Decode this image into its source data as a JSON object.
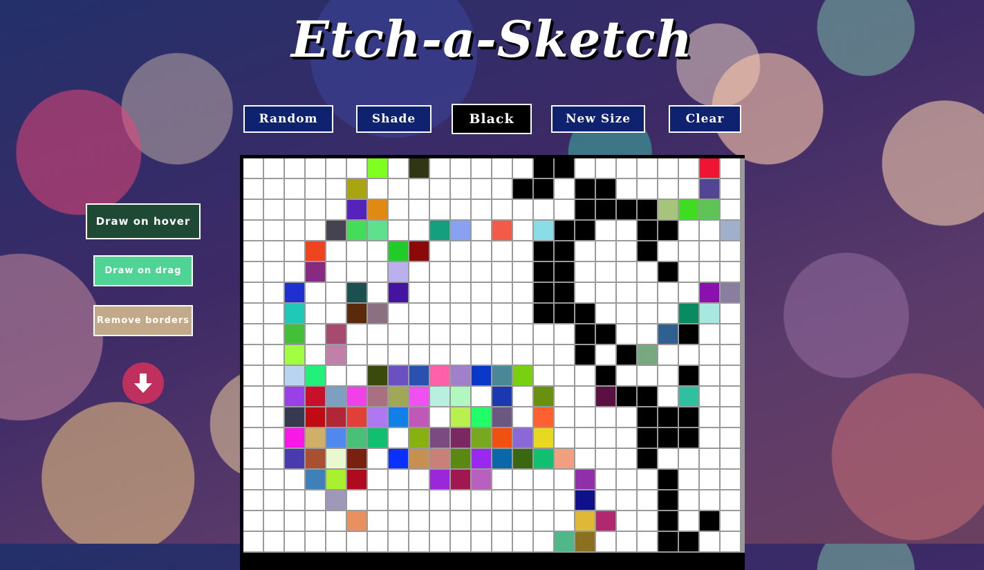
{
  "app_title": "Etch-a-Sketch",
  "toolbar": {
    "random_label": "Random",
    "shade_label": "Shade",
    "black_label": "Black",
    "new_size_label": "New Size",
    "clear_label": "Clear",
    "active_mode": "Black"
  },
  "sidebar": {
    "draw_on_hover_label": "Draw on hover",
    "draw_on_drag_label": "Draw on drag",
    "remove_borders_label": "Remove borders",
    "scroll_down_icon": "arrow-down-icon"
  },
  "colors": {
    "button_navy": "#0e2270",
    "button_black": "#000000",
    "hover_green": "#1e4a35",
    "drag_green": "#4fd496",
    "borders_tan": "#c2a98a",
    "circle_pink": "#c0305e"
  },
  "grid": {
    "columns": 24,
    "visible_rows": 19,
    "painted": [
      [
        0,
        6,
        "#7dff20"
      ],
      [
        0,
        8,
        "#303614"
      ],
      [
        0,
        14,
        "#000"
      ],
      [
        0,
        15,
        "#000"
      ],
      [
        0,
        22,
        "#f01432"
      ],
      [
        1,
        5,
        "#a8a510"
      ],
      [
        1,
        13,
        "#000"
      ],
      [
        1,
        14,
        "#000"
      ],
      [
        1,
        16,
        "#000"
      ],
      [
        1,
        17,
        "#000"
      ],
      [
        1,
        22,
        "#534593"
      ],
      [
        2,
        5,
        "#5522bb"
      ],
      [
        2,
        6,
        "#e08a14"
      ],
      [
        2,
        16,
        "#000"
      ],
      [
        2,
        17,
        "#000"
      ],
      [
        2,
        18,
        "#000"
      ],
      [
        2,
        19,
        "#000"
      ],
      [
        2,
        20,
        "#a7c47c"
      ],
      [
        2,
        21,
        "#3fdc22"
      ],
      [
        2,
        22,
        "#5ec458"
      ],
      [
        3,
        4,
        "#45434f"
      ],
      [
        3,
        5,
        "#44dd5a"
      ],
      [
        3,
        6,
        "#5ee08f"
      ],
      [
        3,
        9,
        "#14a07f"
      ],
      [
        3,
        10,
        "#8aa0f0"
      ],
      [
        3,
        12,
        "#f45a48"
      ],
      [
        3,
        14,
        "#8adce6"
      ],
      [
        3,
        15,
        "#000"
      ],
      [
        3,
        16,
        "#000"
      ],
      [
        3,
        19,
        "#000"
      ],
      [
        3,
        20,
        "#000"
      ],
      [
        3,
        23,
        "#a0b0c8"
      ],
      [
        4,
        3,
        "#ee4420"
      ],
      [
        4,
        7,
        "#22cc28"
      ],
      [
        4,
        8,
        "#8a0a0a"
      ],
      [
        4,
        14,
        "#000"
      ],
      [
        4,
        15,
        "#000"
      ],
      [
        4,
        19,
        "#000"
      ],
      [
        5,
        3,
        "#882a82"
      ],
      [
        5,
        7,
        "#bbb0ee"
      ],
      [
        5,
        14,
        "#000"
      ],
      [
        5,
        15,
        "#000"
      ],
      [
        5,
        20,
        "#000"
      ],
      [
        6,
        2,
        "#2030d0"
      ],
      [
        6,
        5,
        "#1a5050"
      ],
      [
        6,
        7,
        "#4414a0"
      ],
      [
        6,
        14,
        "#000"
      ],
      [
        6,
        15,
        "#000"
      ],
      [
        6,
        22,
        "#8a10b0"
      ],
      [
        6,
        23,
        "#8a7ea0"
      ],
      [
        7,
        2,
        "#20c8b8"
      ],
      [
        7,
        5,
        "#5a2a0a"
      ],
      [
        7,
        6,
        "#8a7080"
      ],
      [
        7,
        14,
        "#000"
      ],
      [
        7,
        15,
        "#000"
      ],
      [
        7,
        16,
        "#000"
      ],
      [
        7,
        21,
        "#0a8a60"
      ],
      [
        7,
        22,
        "#a8e8e0"
      ],
      [
        8,
        2,
        "#44c038"
      ],
      [
        8,
        4,
        "#a84a70"
      ],
      [
        8,
        16,
        "#000"
      ],
      [
        8,
        17,
        "#000"
      ],
      [
        8,
        20,
        "#306090"
      ],
      [
        8,
        21,
        "#000"
      ],
      [
        9,
        2,
        "#a0ff40"
      ],
      [
        9,
        4,
        "#c080a8"
      ],
      [
        9,
        16,
        "#000"
      ],
      [
        9,
        18,
        "#000"
      ],
      [
        9,
        19,
        "#78a880"
      ],
      [
        10,
        2,
        "#b8d4f0"
      ],
      [
        10,
        3,
        "#22f078"
      ],
      [
        10,
        6,
        "#3a4a0a"
      ],
      [
        10,
        7,
        "#6a50c0"
      ],
      [
        10,
        8,
        "#2a50b0"
      ],
      [
        10,
        9,
        "#ff60a8"
      ],
      [
        10,
        10,
        "#a080c8"
      ],
      [
        10,
        11,
        "#0a38c8"
      ],
      [
        10,
        12,
        "#4a8898"
      ],
      [
        10,
        13,
        "#78d010"
      ],
      [
        10,
        17,
        "#000"
      ],
      [
        10,
        21,
        "#000"
      ],
      [
        11,
        2,
        "#9a40e8"
      ],
      [
        11,
        3,
        "#c8102a"
      ],
      [
        11,
        4,
        "#7ea0c0"
      ],
      [
        11,
        5,
        "#f040e8"
      ],
      [
        11,
        6,
        "#a87080"
      ],
      [
        11,
        7,
        "#a0a858"
      ],
      [
        11,
        8,
        "#f050f0"
      ],
      [
        11,
        9,
        "#b8f0e0"
      ],
      [
        11,
        10,
        "#b0f8c0"
      ],
      [
        11,
        12,
        "#1a38b0"
      ],
      [
        11,
        14,
        "#6a9010"
      ],
      [
        11,
        17,
        "#5a1040"
      ],
      [
        11,
        18,
        "#000"
      ],
      [
        11,
        19,
        "#000"
      ],
      [
        11,
        21,
        "#30c0a0"
      ],
      [
        12,
        2,
        "#383850"
      ],
      [
        12,
        3,
        "#c00a14"
      ],
      [
        12,
        4,
        "#b02838"
      ],
      [
        12,
        5,
        "#e04038"
      ],
      [
        12,
        6,
        "#b078f0"
      ],
      [
        12,
        7,
        "#1080e8"
      ],
      [
        12,
        8,
        "#c058b8"
      ],
      [
        12,
        10,
        "#b8f050"
      ],
      [
        12,
        11,
        "#20ff68"
      ],
      [
        12,
        12,
        "#6a5880"
      ],
      [
        12,
        14,
        "#ff6030"
      ],
      [
        12,
        19,
        "#000"
      ],
      [
        12,
        20,
        "#000"
      ],
      [
        12,
        21,
        "#000"
      ],
      [
        13,
        2,
        "#f818e8"
      ],
      [
        13,
        3,
        "#d0b068"
      ],
      [
        13,
        4,
        "#5088f0"
      ],
      [
        13,
        5,
        "#48c078"
      ],
      [
        13,
        6,
        "#10c070"
      ],
      [
        13,
        8,
        "#88b010"
      ],
      [
        13,
        9,
        "#7a4a80"
      ],
      [
        13,
        10,
        "#7a2860"
      ],
      [
        13,
        11,
        "#78a820"
      ],
      [
        13,
        12,
        "#f05010"
      ],
      [
        13,
        13,
        "#8a68d8"
      ],
      [
        13,
        14,
        "#e8d820"
      ],
      [
        13,
        19,
        "#000"
      ],
      [
        13,
        20,
        "#000"
      ],
      [
        13,
        21,
        "#000"
      ],
      [
        14,
        2,
        "#4a3ab0"
      ],
      [
        14,
        3,
        "#a85030"
      ],
      [
        14,
        4,
        "#eaf8d0"
      ],
      [
        14,
        5,
        "#7a2010"
      ],
      [
        14,
        7,
        "#0a30ff"
      ],
      [
        14,
        8,
        "#c89050"
      ],
      [
        14,
        9,
        "#c88078"
      ],
      [
        14,
        10,
        "#5a8810"
      ],
      [
        14,
        11,
        "#9a28f0"
      ],
      [
        14,
        12,
        "#0a68a8"
      ],
      [
        14,
        13,
        "#3a6810"
      ],
      [
        14,
        14,
        "#10c070"
      ],
      [
        14,
        15,
        "#f0a080"
      ],
      [
        14,
        19,
        "#000"
      ],
      [
        15,
        3,
        "#4080b8"
      ],
      [
        15,
        4,
        "#a8f030"
      ],
      [
        15,
        5,
        "#b00a20"
      ],
      [
        15,
        9,
        "#9a28d8"
      ],
      [
        15,
        10,
        "#a01850"
      ],
      [
        15,
        11,
        "#b860c0"
      ],
      [
        15,
        16,
        "#9030a8"
      ],
      [
        15,
        20,
        "#000"
      ],
      [
        16,
        4,
        "#a098b8"
      ],
      [
        16,
        16,
        "#10108a"
      ],
      [
        16,
        20,
        "#000"
      ],
      [
        17,
        5,
        "#e89060"
      ],
      [
        17,
        16,
        "#e0b838"
      ],
      [
        17,
        17,
        "#b02870"
      ],
      [
        17,
        20,
        "#000"
      ],
      [
        17,
        22,
        "#000"
      ],
      [
        18,
        15,
        "#50b888"
      ],
      [
        18,
        16,
        "#8a7020"
      ],
      [
        18,
        20,
        "#000"
      ],
      [
        18,
        21,
        "#000"
      ]
    ]
  }
}
